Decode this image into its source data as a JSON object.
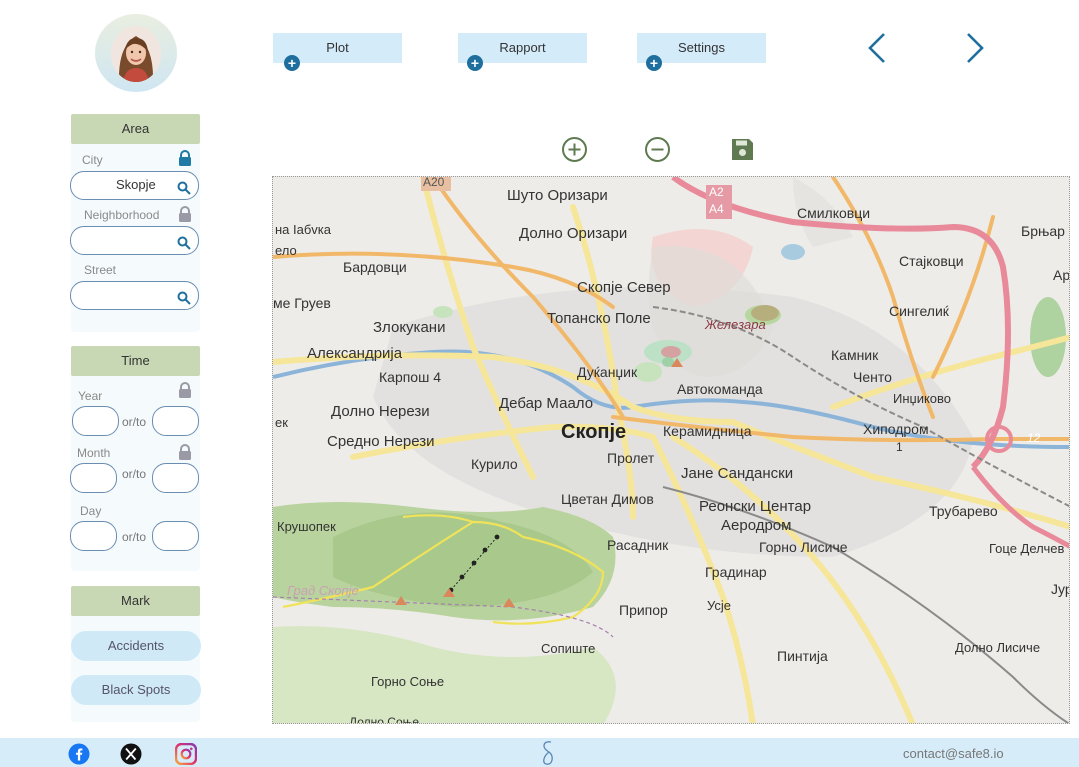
{
  "nav": {
    "tabs": [
      {
        "label": "Plot"
      },
      {
        "label": "Rapport"
      },
      {
        "label": "Settings"
      }
    ]
  },
  "sidebar": {
    "area": {
      "title": "Area",
      "city_label": "City",
      "city_value": "Skopje",
      "neighborhood_label": "Neighborhood",
      "street_label": "Street"
    },
    "time": {
      "title": "Time",
      "year_label": "Year",
      "month_label": "Month",
      "day_label": "Day",
      "range_sep": "or/to"
    },
    "mark": {
      "title": "Mark",
      "accidents": "Accidents",
      "black_spots": "Black Spots"
    }
  },
  "map": {
    "labels": {
      "a20": "A20",
      "shuto": "Шуто Оризари",
      "a2": "A2",
      "a4": "A4",
      "smilkovci": "Смилковци",
      "brnjari": "Брњар",
      "lablvka": "на Іабvка",
      "elo": "ело",
      "dolno_orizari": "Долно Оризари",
      "bardovci": "Бардовци",
      "stajkovci": "Стајковци",
      "ap": "Ap",
      "skopje_sever": "Скопје Север",
      "gruev": "ме Груев",
      "singelik": "Сингелиќ",
      "zlokukani": "Злокукани",
      "topansko": "Топанско Поле",
      "zhelezara": "Железара",
      "aleksandrija": "Александрија",
      "kamnik": "Камник",
      "karposh": "Карпош 4",
      "dukjandzhik": "Дуќанџик",
      "chento": "Ченто",
      "avtokomanda": "Автокоманда",
      "inchikovo": "Инџиково",
      "dolno_nerezi": "Долно Нерези",
      "debar_maalo": "Дебар Маало",
      "ek": "ек",
      "skopje": "Скопје",
      "keramidnica": "Керамидница",
      "hipodrom": "Хиподром",
      "num_1": "1",
      "num_12": "12",
      "sredno_nerezi": "Средно Нерези",
      "prolet": "Пролет",
      "kurilo": "Курило",
      "jane": "Јане Сандански",
      "cvetan": "Цветан Димов",
      "reonski": "Реонски Центар",
      "trubarevo": "Трубарево",
      "krushopek": "Крушопек",
      "aerodrom": "Аеродром",
      "goce": "Гоце Делчев",
      "rasadnik": "Расадник",
      "gorno_lisiche": "Горно Лисиче",
      "grad_skopje": "Град Скопје",
      "gradinar": "Градинар",
      "jur": "Јур",
      "pripor": "Припор",
      "usje": "Усје",
      "sopishte": "Сопиште",
      "pintija": "Пинтија",
      "dolno_lisiche": "Долно Лисиче",
      "gorno_sonje": "Горно Соње",
      "dolno_sonje": "Долно Соње"
    }
  },
  "footer": {
    "contact": "contact@safe8.io"
  }
}
